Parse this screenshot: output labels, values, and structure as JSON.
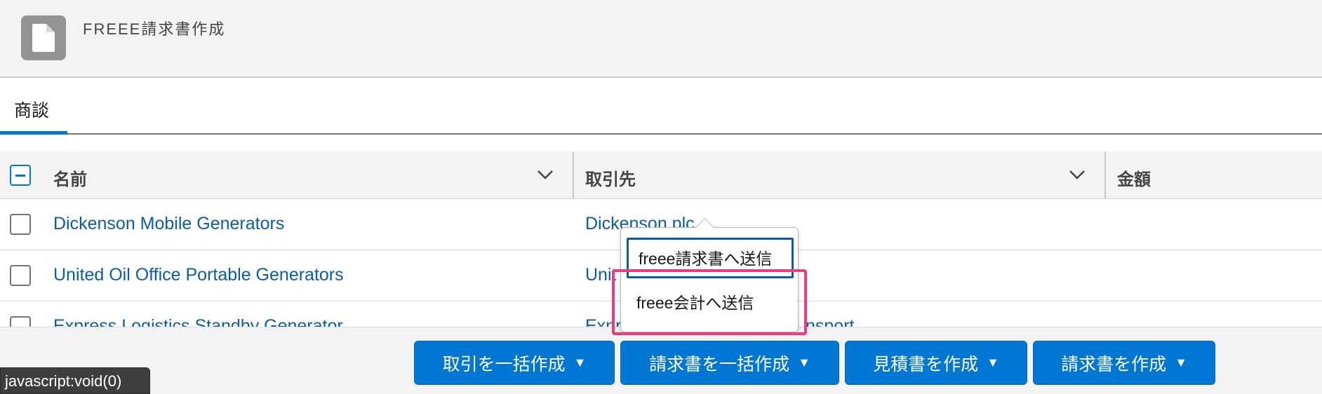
{
  "header": {
    "title": "FREEE請求書作成",
    "icon": "document-icon"
  },
  "tabs": [
    {
      "label": "商談",
      "active": true
    }
  ],
  "table": {
    "columns": [
      "名前",
      "取引先",
      "金額"
    ],
    "rows": [
      {
        "name": "Dickenson Mobile Generators",
        "account": "Dickenson plc"
      },
      {
        "name": "United Oil Office Portable Generators",
        "account": "Unit"
      },
      {
        "name": "Express Logistics Standby Generator",
        "account": "Expr",
        "account_tail": "nsport"
      }
    ]
  },
  "dropdown": {
    "items": [
      {
        "label": "freee請求書へ送信",
        "focused": true
      },
      {
        "label": "freee会計へ送信",
        "focused": false
      }
    ]
  },
  "actions": {
    "bulk_deal": "取引を一括作成",
    "bulk_invoice": "請求書を一括作成",
    "quote": "見積書を作成",
    "invoice": "請求書を作成"
  },
  "status_bar": "javascript:void(0)",
  "colors": {
    "brand": "#0176d3",
    "link": "#0b5cab",
    "highlight": "#ea3d7a"
  }
}
